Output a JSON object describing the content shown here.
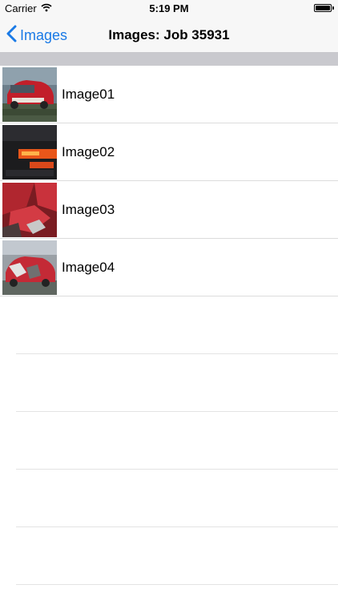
{
  "status_bar": {
    "carrier": "Carrier",
    "time": "5:19 PM",
    "wifi_icon": "wifi-icon",
    "battery_icon": "battery-icon"
  },
  "nav": {
    "back_label": "Images",
    "back_icon": "chevron-left-icon",
    "title": "Images: Job 35931",
    "accent_color": "#1a7ae6"
  },
  "rows": [
    {
      "label": "Image01"
    },
    {
      "label": "Image02"
    },
    {
      "label": "Image03"
    },
    {
      "label": "Image04"
    }
  ]
}
